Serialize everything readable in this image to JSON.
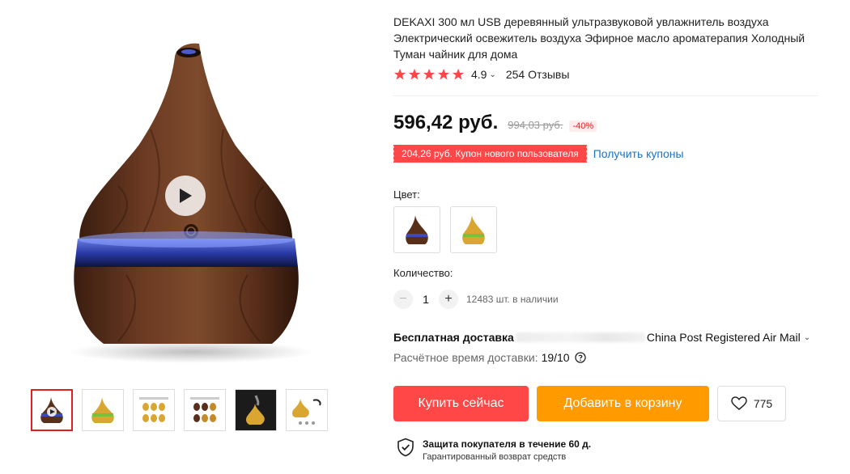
{
  "product": {
    "title": "DEKAXI 300 мл USB деревянный ультразвуковой увлажнитель воздуха Электрический освежитель воздуха Эфирное масло ароматерапия Холодный Туман чайник для дома",
    "rating": "4.9",
    "rating_chevron": "⌄",
    "reviews": "254 Отзывы",
    "stars": 5
  },
  "price": {
    "current": "596,42 руб.",
    "old": "994,03 руб.",
    "discount": "-40%"
  },
  "coupon": {
    "text": "204,26 руб. Купон нового пользователя",
    "link": "Получить купоны"
  },
  "color": {
    "label": "Цвет:",
    "options": [
      "dark-wood",
      "light-wood"
    ]
  },
  "quantity": {
    "label": "Количество:",
    "minus": "−",
    "value": "1",
    "plus": "+",
    "stock": "12483 шт. в наличии"
  },
  "shipping": {
    "label": "Бесплатная доставка",
    "carrier": "China Post Registered Air Mail",
    "chevron": "⌄",
    "eta_label": "Расчётное время доставки:",
    "eta_value": "19/10"
  },
  "actions": {
    "buy": "Купить сейчас",
    "cart": "Добавить в корзину",
    "wishlist_count": "775"
  },
  "protection": {
    "title": "Защита покупателя в течение 60 д.",
    "subtitle": "Гарантированный возврат средств"
  },
  "colors": {
    "accent_red": "#ff4747",
    "accent_orange": "#ff9a00",
    "link_blue": "#1a74c7",
    "star": "#ff4747"
  }
}
